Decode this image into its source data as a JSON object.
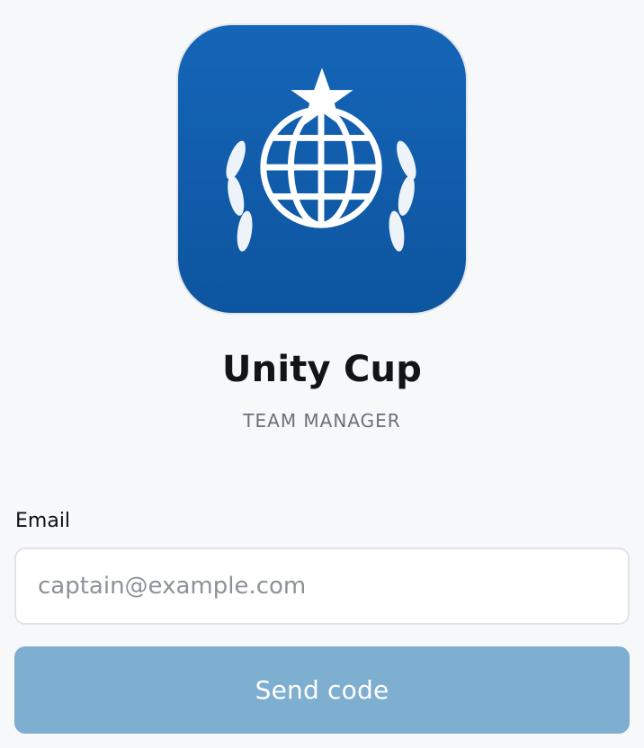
{
  "app": {
    "title": "Unity Cup",
    "subtitle": "TEAM MANAGER",
    "logo_icon": "globe-star-laurel-icon",
    "brand_color": "#1565b8"
  },
  "form": {
    "email_label": "Email",
    "email_placeholder": "captain@example.com",
    "email_value": "",
    "send_button_label": "Send code",
    "send_button_color": "#7eaed0"
  }
}
